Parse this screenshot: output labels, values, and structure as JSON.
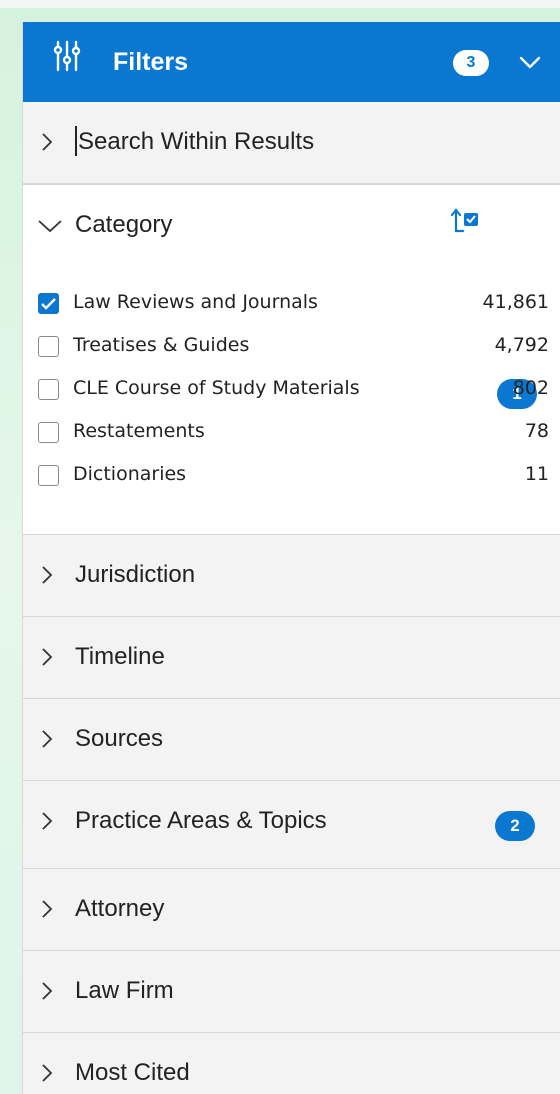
{
  "header": {
    "title": "Filters",
    "count": "3"
  },
  "search": {
    "label": "Search Within Results"
  },
  "category": {
    "label": "Category",
    "badge": "1",
    "items": [
      {
        "name": "Law Reviews and Journals",
        "count": "41,861",
        "checked": true
      },
      {
        "name": "Treatises & Guides",
        "count": "4,792",
        "checked": false
      },
      {
        "name": "CLE Course of Study Materials",
        "count": "802",
        "checked": false
      },
      {
        "name": "Restatements",
        "count": "78",
        "checked": false
      },
      {
        "name": "Dictionaries",
        "count": "11",
        "checked": false
      }
    ]
  },
  "sections": {
    "jurisdiction": "Jurisdiction",
    "timeline": "Timeline",
    "sources": "Sources",
    "practice_areas": "Practice Areas & Topics",
    "practice_areas_badge": "2",
    "attorney": "Attorney",
    "law_firm": "Law Firm",
    "most_cited": "Most Cited"
  },
  "colors": {
    "accent": "#0a78d1",
    "panel_bg": "#f3f3f3"
  }
}
